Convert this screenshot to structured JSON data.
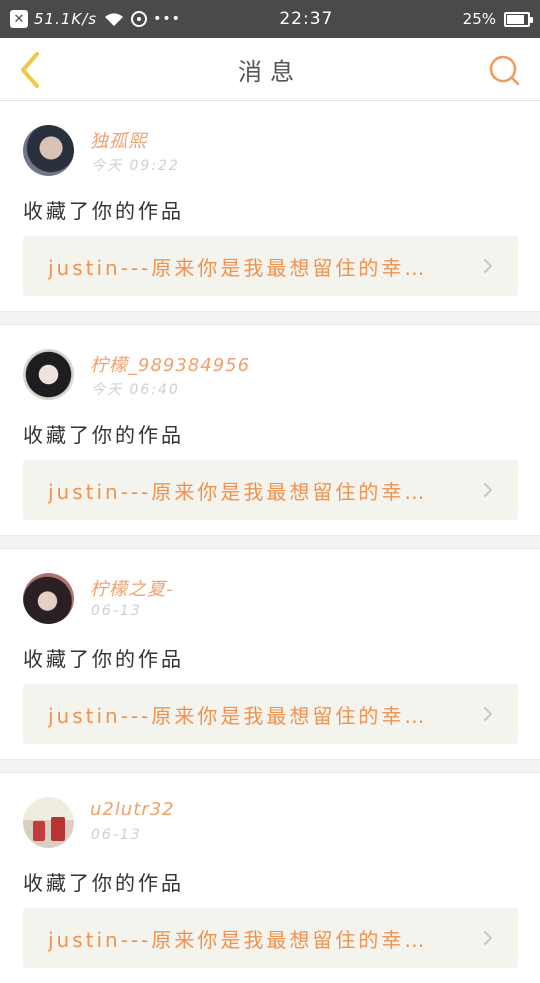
{
  "status_bar": {
    "network_speed": "51.1K/s",
    "more": "•••",
    "time": "22:37",
    "battery": "25%"
  },
  "nav": {
    "title": "消息",
    "back_icon": "chevron-left-icon",
    "search_icon": "search-icon"
  },
  "colors": {
    "accent_orange": "#f0924e",
    "username_orange": "#f0a06a",
    "back_yellow": "#f2c84b",
    "search_orange": "#f39a5a"
  },
  "notifications": [
    {
      "username": "独孤熙",
      "time": "今天 09:22",
      "action": "收藏了你的作品",
      "work_title": "justin---原来你是我最想留住的幸…"
    },
    {
      "username": "柠檬_989384956",
      "time": "今天 06:40",
      "action": "收藏了你的作品",
      "work_title": "justin---原来你是我最想留住的幸…"
    },
    {
      "username": "柠檬之夏-",
      "time": "06-13",
      "action": "收藏了你的作品",
      "work_title": "justin---原来你是我最想留住的幸…"
    },
    {
      "username": "u2lutr32",
      "time": "06-13",
      "action": "收藏了你的作品",
      "work_title": "justin---原来你是我最想留住的幸…"
    }
  ]
}
